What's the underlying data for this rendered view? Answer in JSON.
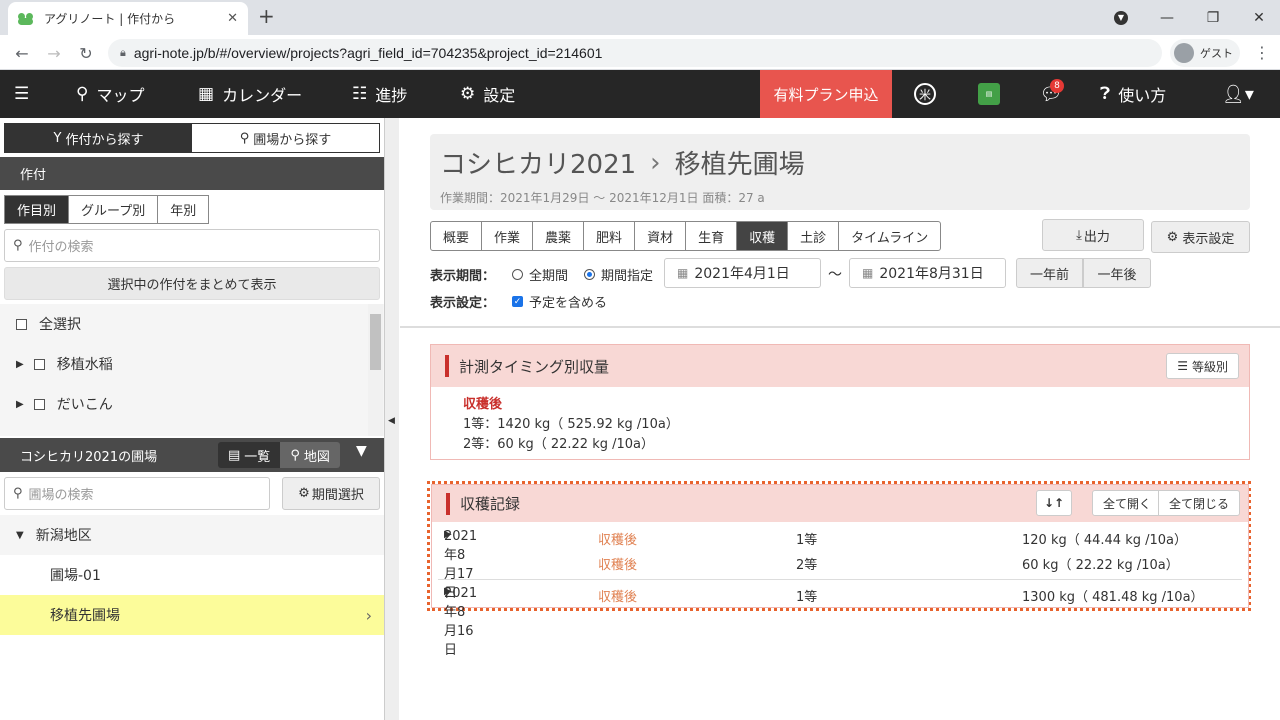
{
  "browser": {
    "tab_title": "アグリノート | 作付から",
    "new_tab": "+",
    "url": "agri-note.jp/b/#/overview/projects?agri_field_id=704235&project_id=214601",
    "guest_label": "ゲスト"
  },
  "nav": {
    "map": "マップ",
    "calendar": "カレンダー",
    "progress": "進捗",
    "settings": "設定",
    "promo": "有料プラン申込",
    "notif_count": "8",
    "help": "使い方",
    "book_label": "農業\n日誌"
  },
  "sidebar": {
    "seg_crop": "作付から探す",
    "seg_field": "圃場から探す",
    "crop_head": "作付",
    "crop_tabs": [
      "作目別",
      "グループ別",
      "年別"
    ],
    "crop_search_placeholder": "作付の検索",
    "show_selected": "選択中の作付をまとめて表示",
    "select_all": "全選択",
    "crops": [
      "移植水稲",
      "だいこん"
    ],
    "field_head": "コシヒカリ2021の圃場",
    "view_list": "一覧",
    "view_map": "地図",
    "field_search_placeholder": "圃場の検索",
    "period_select": "期間選択",
    "region": "新潟地区",
    "fields": [
      "圃場-01",
      "移植先圃場"
    ]
  },
  "main": {
    "title_crop": "コシヒカリ2021",
    "title_field": "移植先圃場",
    "subtitle": "作業期間：2021年1月29日 〜 2021年12月1日  面積：27 a",
    "tabs": [
      "概要",
      "作業",
      "農薬",
      "肥料",
      "資材",
      "生育",
      "収穫",
      "土診",
      "タイムライン"
    ],
    "active_tab": "収穫",
    "export": "出力",
    "display_settings": "表示設定",
    "period_label": "表示期間：",
    "all_period": "全期間",
    "period_specify": "期間指定",
    "date_from": "2021年4月1日",
    "tilde": "〜",
    "date_to": "2021年8月31日",
    "year_prev": "一年前",
    "year_next": "一年後",
    "display_label": "表示設定：",
    "include_plan": "予定を含める"
  },
  "timing_panel": {
    "title": "計測タイミング別収量",
    "grade_button": "等級別",
    "label": "収穫後",
    "lines": [
      "1等：1420 kg（ 525.92 kg /10a）",
      "2等：60 kg（ 22.22 kg /10a）"
    ]
  },
  "records_panel": {
    "title": "収穫記録",
    "sort_icon": "↓↑",
    "expand_all": "全て開く",
    "collapse_all": "全て閉じる",
    "rows": [
      {
        "date": "2021年8月17日",
        "type": "収穫後",
        "grade": "1等",
        "amount": "120 kg（ 44.44 kg /10a）"
      },
      {
        "date": "",
        "type": "収穫後",
        "grade": "2等",
        "amount": "60 kg（ 22.22 kg /10a）"
      },
      {
        "date": "2021年8月16日",
        "type": "収穫後",
        "grade": "1等",
        "amount": "1300 kg（ 481.48 kg /10a）"
      }
    ]
  },
  "colors": {
    "nav_bg": "#262626",
    "promo": "#e8554e",
    "panel_head": "#f8d8d5",
    "accent_red": "#c9302c",
    "selected_field": "#fcfc9a",
    "dashed_border": "#e8632d"
  }
}
